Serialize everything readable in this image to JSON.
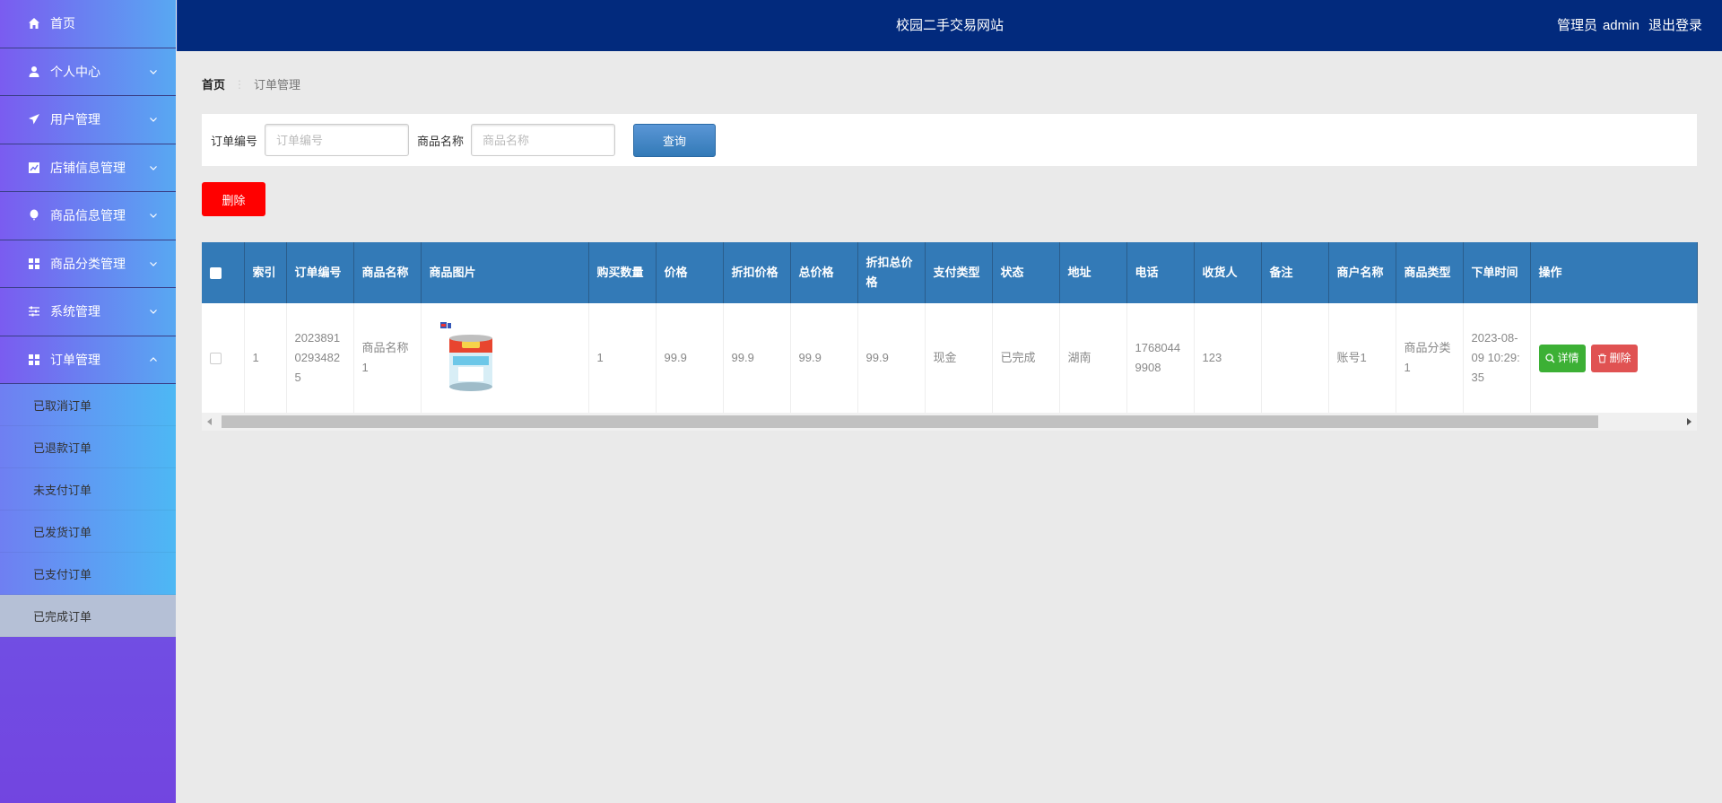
{
  "header": {
    "title": "校园二手交易网站",
    "user_role": "管理员",
    "username": "admin",
    "logout": "退出登录"
  },
  "sidebar": {
    "items": [
      {
        "label": "首页",
        "icon": "home-icon"
      },
      {
        "label": "个人中心",
        "icon": "user-icon"
      },
      {
        "label": "用户管理",
        "icon": "paper-plane-icon"
      },
      {
        "label": "店铺信息管理",
        "icon": "chart-icon"
      },
      {
        "label": "商品信息管理",
        "icon": "balloon-icon"
      },
      {
        "label": "商品分类管理",
        "icon": "grid-icon"
      },
      {
        "label": "系统管理",
        "icon": "sliders-icon"
      },
      {
        "label": "订单管理",
        "icon": "grid-icon"
      }
    ],
    "sub_items": [
      {
        "label": "已取消订单"
      },
      {
        "label": "已退款订单"
      },
      {
        "label": "未支付订单"
      },
      {
        "label": "已发货订单"
      },
      {
        "label": "已支付订单"
      },
      {
        "label": "已完成订单"
      }
    ]
  },
  "breadcrumb": {
    "home": "首页",
    "current": "订单管理"
  },
  "search": {
    "order_no_label": "订单编号",
    "order_no_placeholder": "订单编号",
    "product_label": "商品名称",
    "product_placeholder": "商品名称",
    "query_button": "查询"
  },
  "actions": {
    "delete_button": "删除"
  },
  "table": {
    "columns": [
      "索引",
      "订单编号",
      "商品名称",
      "商品图片",
      "购买数量",
      "价格",
      "折扣价格",
      "总价格",
      "折扣总价格",
      "支付类型",
      "状态",
      "地址",
      "电话",
      "收货人",
      "备注",
      "商户名称",
      "商品类型",
      "下单时间",
      "操作"
    ],
    "rows": [
      {
        "index": "1",
        "order_no": "20238910293482 5",
        "product_name": "商品名称1",
        "quantity": "1",
        "price": "99.9",
        "discount_price": "99.9",
        "total_price": "99.9",
        "discount_total": "99.9",
        "pay_type": "现金",
        "status": "已完成",
        "address": "湖南",
        "phone": "17680449908",
        "receiver": "123",
        "remark": "",
        "merchant": "账号1",
        "category": "商品分类1",
        "order_time": "2023-08-09 10:29:35",
        "detail_button": "详情",
        "delete_button": "删除"
      }
    ]
  },
  "colors": {
    "header_bg": "#022a7d",
    "table_header_bg": "#337ab7",
    "delete_red": "#ff0000",
    "detail_green": "#3cb035"
  }
}
